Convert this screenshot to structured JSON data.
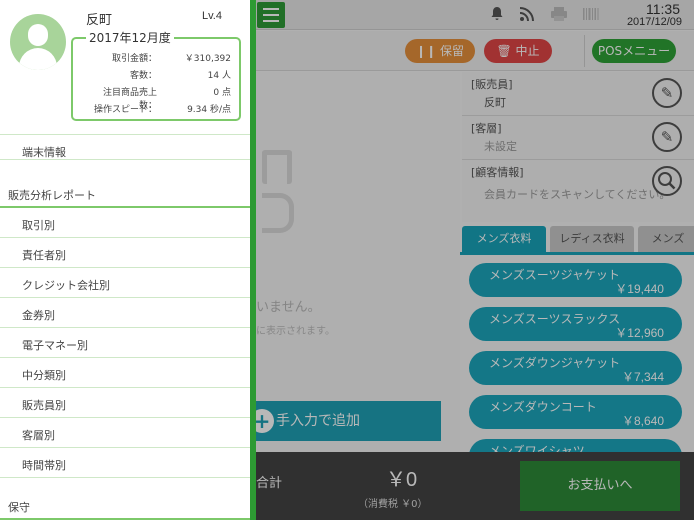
{
  "status": {
    "time": "11:35",
    "date": "2017/12/09"
  },
  "actions": {
    "hold": "保留",
    "stop": "中止",
    "pos_menu": "POSメニュー"
  },
  "center": {
    "empty_message": "いません。",
    "empty_sub": "に表示されます。",
    "manual_add": "手入力で追加"
  },
  "info": {
    "staff_label": "[販売員]",
    "staff_value": "反町",
    "segment_label": "[客層]",
    "segment_value": "未設定",
    "customer_label": "[顧客情報]",
    "customer_value": "会員カードをスキャンしてください。"
  },
  "categories": {
    "tab1": "メンズ衣料",
    "tab2": "レディス衣料",
    "tab3": "メンズ"
  },
  "products": [
    {
      "name": "メンズスーツジャケット",
      "price": "￥19,440"
    },
    {
      "name": "メンズスーツスラックス",
      "price": "￥12,960"
    },
    {
      "name": "メンズダウンジャケット",
      "price": "￥7,344"
    },
    {
      "name": "メンズダウンコート",
      "price": "￥8,640"
    },
    {
      "name": "メンズワイシャツ",
      "price": ""
    }
  ],
  "totals": {
    "label": "合計",
    "amount": "￥0",
    "tax": "（消費税 ￥0）",
    "pay": "お支払いへ"
  },
  "drawer": {
    "user_name": "反町",
    "level": "Lv.4",
    "period": "2017年12月度",
    "stats": [
      {
        "key": "取引金額：",
        "value": "￥310,392"
      },
      {
        "key": "客数：",
        "value": "14 人"
      },
      {
        "key": "注目商品売上数：",
        "value": "0 点"
      },
      {
        "key": "操作スピード：",
        "value": "9.34 秒/点"
      }
    ],
    "terminal_info": "端末情報",
    "sales_report_header": "販売分析レポート",
    "report_items": [
      "取引別",
      "責任者別",
      "クレジット会社別",
      "金券別",
      "電子マネー別",
      "中分類別",
      "販売員別",
      "客層別",
      "時間帯別"
    ],
    "maintenance_header": "保守"
  }
}
